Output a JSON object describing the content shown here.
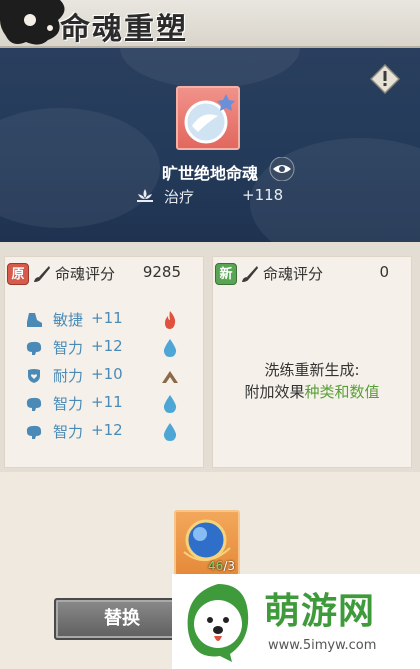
{
  "header": {
    "title": "命魂重塑"
  },
  "item": {
    "name": "旷世绝地命魂",
    "stat_name": "治疗",
    "stat_value": "+118"
  },
  "original": {
    "badge": "原",
    "score_label": "命魂评分",
    "score": "9285",
    "attributes": [
      {
        "name": "敏捷",
        "value": "+11",
        "icon": "boot-icon",
        "gem": "fire-gem-icon"
      },
      {
        "name": "智力",
        "value": "+12",
        "icon": "brain-icon",
        "gem": "water-gem-icon"
      },
      {
        "name": "耐力",
        "value": "+10",
        "icon": "shield-heart-icon",
        "gem": "earth-gem-icon"
      },
      {
        "name": "智力",
        "value": "+11",
        "icon": "brain-icon",
        "gem": "water-gem-icon"
      },
      {
        "name": "智力",
        "value": "+12",
        "icon": "brain-icon",
        "gem": "water-gem-icon"
      }
    ]
  },
  "new": {
    "badge": "新",
    "score_label": "命魂评分",
    "score": "0",
    "line1": "洗练重新生成:",
    "line2_prefix": "附加效果",
    "line2_highlight": "种类和数值"
  },
  "material": {
    "have": "46",
    "separator": "/",
    "need": "3"
  },
  "actions": {
    "replace_label": "替换"
  },
  "watermark": {
    "brand": "萌游网",
    "url": "www.5imyw.com"
  },
  "colors": {
    "panel_blue": "#233a59",
    "attr_blue": "#4b8ab6",
    "highlight_green": "#5a9e3a"
  }
}
